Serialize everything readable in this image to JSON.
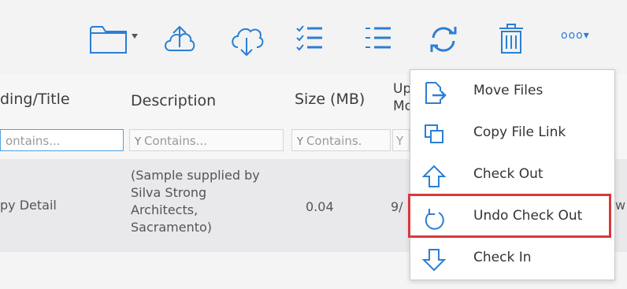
{
  "toolbar": {
    "icons": [
      "folder-icon",
      "dropdown-caret-icon",
      "upload-icon",
      "cloud-download-icon",
      "checklist-icon",
      "list-icon",
      "refresh-icon",
      "trash-icon",
      "more-icon"
    ],
    "more_label": "ooo▾"
  },
  "table": {
    "headers": {
      "title": "ding/Title",
      "description": "Description",
      "size": "Size (MB)",
      "uploaded_line1": "Up",
      "uploaded_line2": "Mo"
    },
    "filters": {
      "title": "ontains...",
      "description": "Contains...",
      "size": "Contains.",
      "uploaded": "Y"
    },
    "row": {
      "title": "py Detail",
      "description": [
        "(Sample supplied by",
        "Silva Strong",
        "Architects,",
        "Sacramento)"
      ],
      "size": "0.04",
      "uploaded": "9/",
      "trailing": "w"
    }
  },
  "menu": {
    "items": [
      {
        "label": "Move Files",
        "icon": "move-files-icon"
      },
      {
        "label": "Copy File Link",
        "icon": "copy-link-icon"
      },
      {
        "label": "Check Out",
        "icon": "check-out-icon"
      },
      {
        "label": "Undo Check Out",
        "icon": "undo-check-out-icon",
        "highlighted": true
      },
      {
        "label": "Check In",
        "icon": "check-in-icon"
      }
    ]
  },
  "colors": {
    "accent": "#2b7fd4",
    "highlight_border": "#d9373c"
  }
}
